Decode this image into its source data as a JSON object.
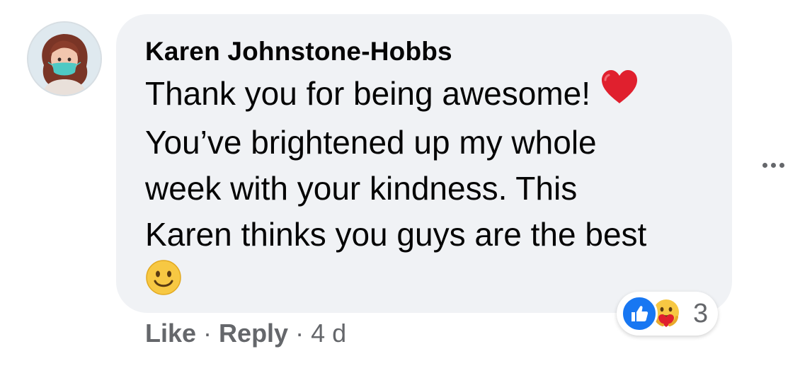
{
  "comment": {
    "author": "Karen Johnstone-Hobbs",
    "lines": [
      "Thank you for being awesome!",
      "You’ve brightened up my whole",
      "week with your kindness. This",
      "Karen thinks you guys are the best"
    ],
    "emojis": {
      "line1": "red-heart",
      "line5": "smiling-face"
    }
  },
  "reactions": {
    "icons": [
      "like-icon",
      "care-icon"
    ],
    "count": "3"
  },
  "actions": {
    "like_label": "Like",
    "separator": "·",
    "reply_label": "Reply",
    "timestamp": "4 d"
  },
  "colors": {
    "bubble": "#f0f2f5",
    "text": "#050505",
    "muted": "#65676b",
    "like_blue": "#1877f2",
    "heart_red": "#e0202e",
    "emoji_yellow": "#f7c843"
  }
}
